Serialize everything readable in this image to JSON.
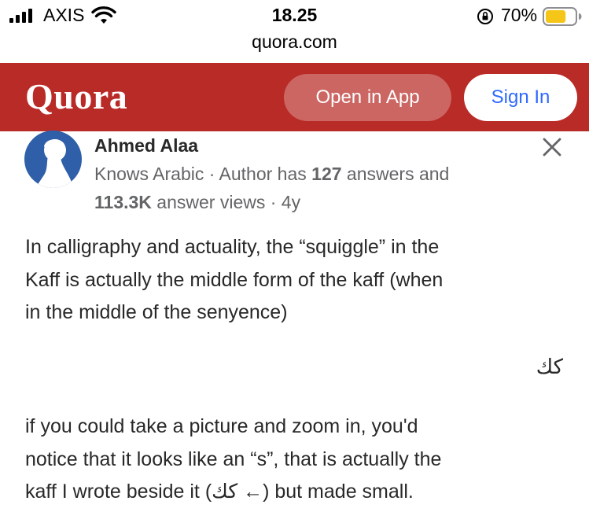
{
  "status_bar": {
    "carrier": "AXIS",
    "time": "18.25",
    "battery_percent": "70%",
    "battery_level": 0.7,
    "battery_color": "#f5c518",
    "url": "quora.com"
  },
  "header": {
    "logo": "Quora",
    "open_in_app_label": "Open in App",
    "sign_in_label": "Sign In",
    "brand_color": "#b92b27"
  },
  "author": {
    "name": "Ahmed Alaa",
    "knows": "Knows Arabic",
    "sep1": " · ",
    "author_has": "Author has ",
    "answers_count": "127",
    "answers_and": " answers and",
    "views_count": "113.3K",
    "answer_views": " answer views",
    "sep2": " · ",
    "age": "4y"
  },
  "answer": {
    "paragraph1_line1": "In calligraphy and actuality, the “squiggle” in the",
    "paragraph1_line2": "Kaff is actually the middle form of the kaff (when",
    "paragraph1_line3": "in the middle of the senyence)",
    "arabic_sample": "كك",
    "paragraph2_line1": "if you could take a picture and zoom in, you'd",
    "paragraph2_line2": "notice that it looks like an “s”, that is actually the",
    "paragraph2_line3": "kaff I wrote beside it (كك ←) but made small."
  }
}
